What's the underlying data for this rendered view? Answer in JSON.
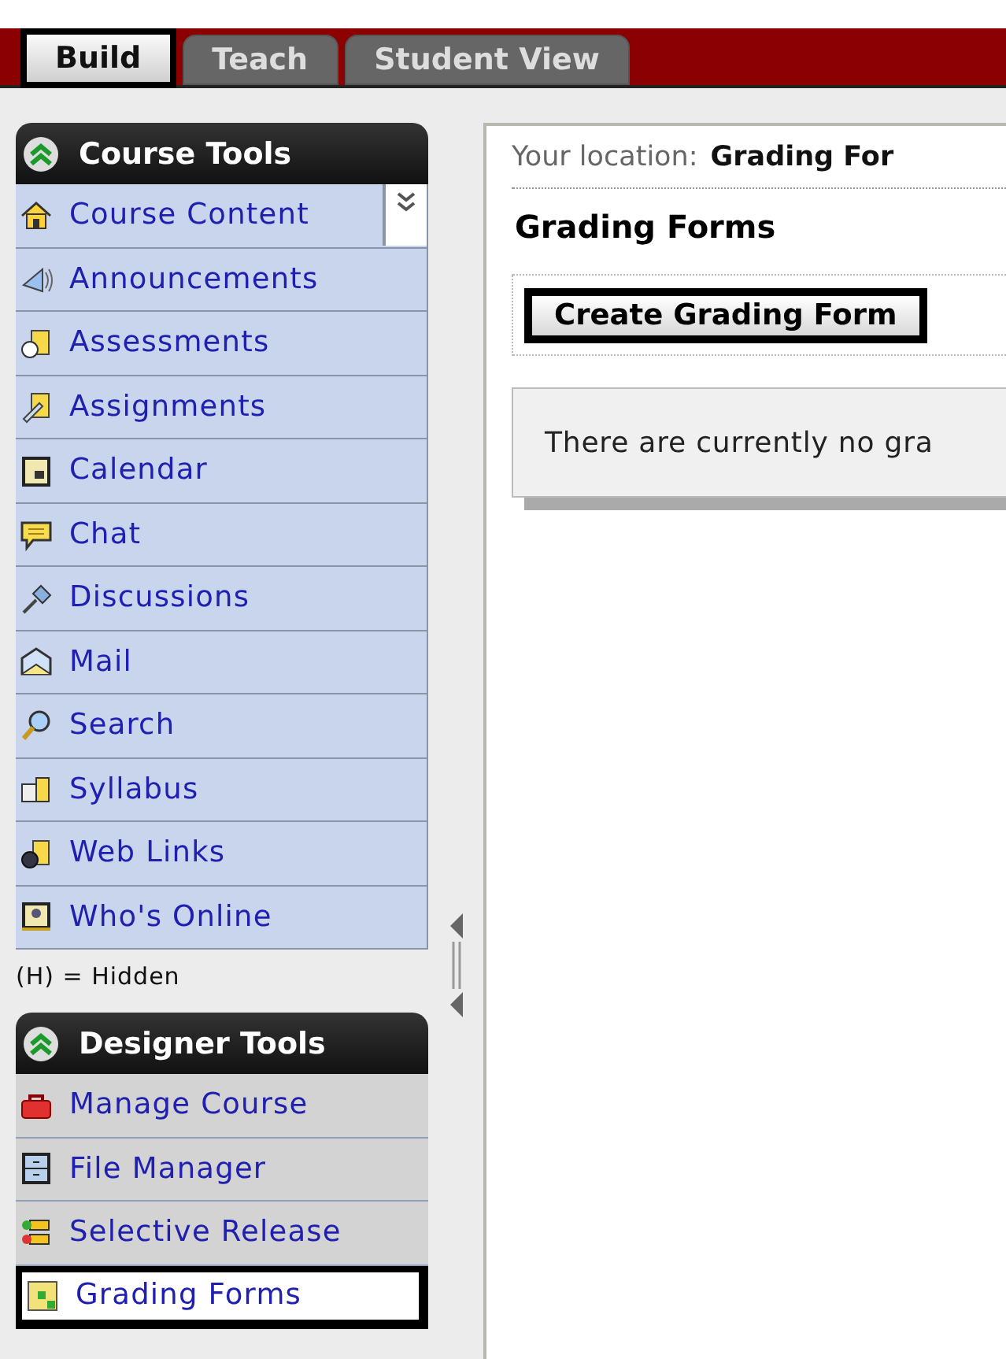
{
  "tabs": [
    {
      "label": "Build",
      "selected": true
    },
    {
      "label": "Teach",
      "selected": false
    },
    {
      "label": "Student View",
      "selected": false
    }
  ],
  "sections": [
    {
      "kind": "course",
      "title": "Course Tools",
      "expanded": true,
      "items": [
        {
          "label": "Course Content",
          "selected": false,
          "menu": true
        },
        {
          "label": "Announcements",
          "selected": false,
          "menu": false
        },
        {
          "label": "Assessments",
          "selected": false,
          "menu": false
        },
        {
          "label": "Assignments",
          "selected": false,
          "menu": false
        },
        {
          "label": "Calendar",
          "selected": false,
          "menu": false
        },
        {
          "label": "Chat",
          "selected": false,
          "menu": false
        },
        {
          "label": "Discussions",
          "selected": false,
          "menu": false
        },
        {
          "label": "Mail",
          "selected": false,
          "menu": false
        },
        {
          "label": "Search",
          "selected": false,
          "menu": false
        },
        {
          "label": "Syllabus",
          "selected": false,
          "menu": false
        },
        {
          "label": "Web Links",
          "selected": false,
          "menu": false
        },
        {
          "label": "Who's Online",
          "selected": false,
          "menu": false
        }
      ],
      "note": "(H) = Hidden"
    },
    {
      "kind": "designer",
      "title": "Designer Tools",
      "expanded": true,
      "items": [
        {
          "label": "Manage Course",
          "selected": false,
          "menu": false
        },
        {
          "label": "File Manager",
          "selected": false,
          "menu": false
        },
        {
          "label": "Selective Release",
          "selected": false,
          "menu": false
        },
        {
          "label": "Grading Forms",
          "selected": true,
          "menu": false
        }
      ]
    }
  ],
  "content": {
    "location_label": "Your location:",
    "location": "Grading For",
    "heading": "Grading Forms",
    "button": "Create Grading Form",
    "message": "There are currently no gra"
  }
}
